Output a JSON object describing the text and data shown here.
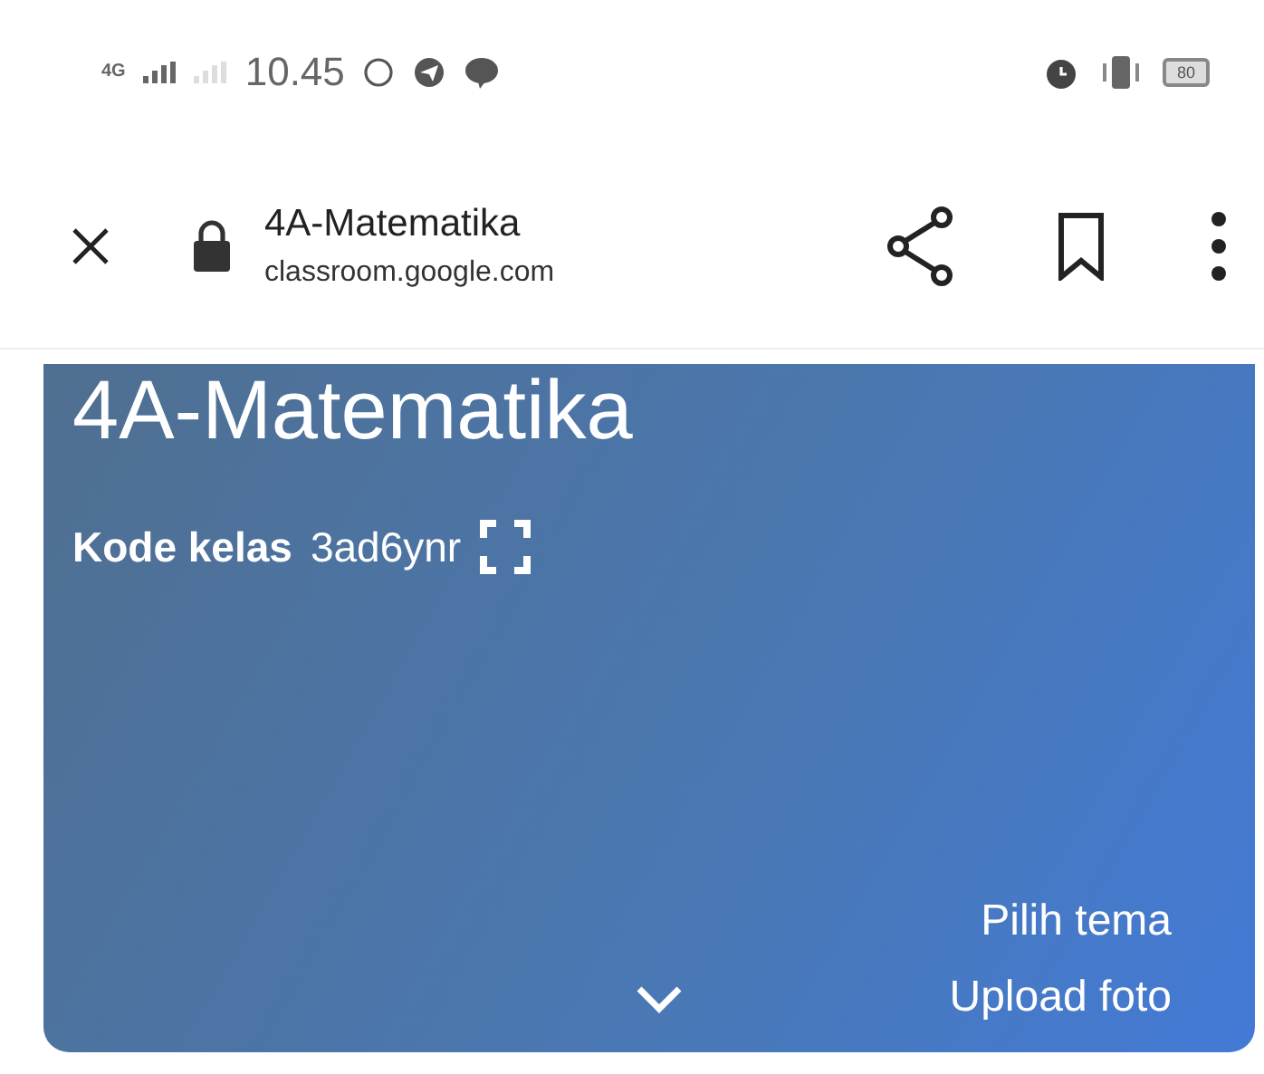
{
  "status_bar": {
    "network": "4G",
    "time": "10.45",
    "battery": "80"
  },
  "browser_bar": {
    "title": "4A-Matematika",
    "url": "classroom.google.com"
  },
  "banner": {
    "title": "4A-Matematika",
    "code_label": "Kode kelas",
    "code": "3ad6ynr",
    "links": [
      "Pilih tema",
      "Upload foto"
    ]
  }
}
